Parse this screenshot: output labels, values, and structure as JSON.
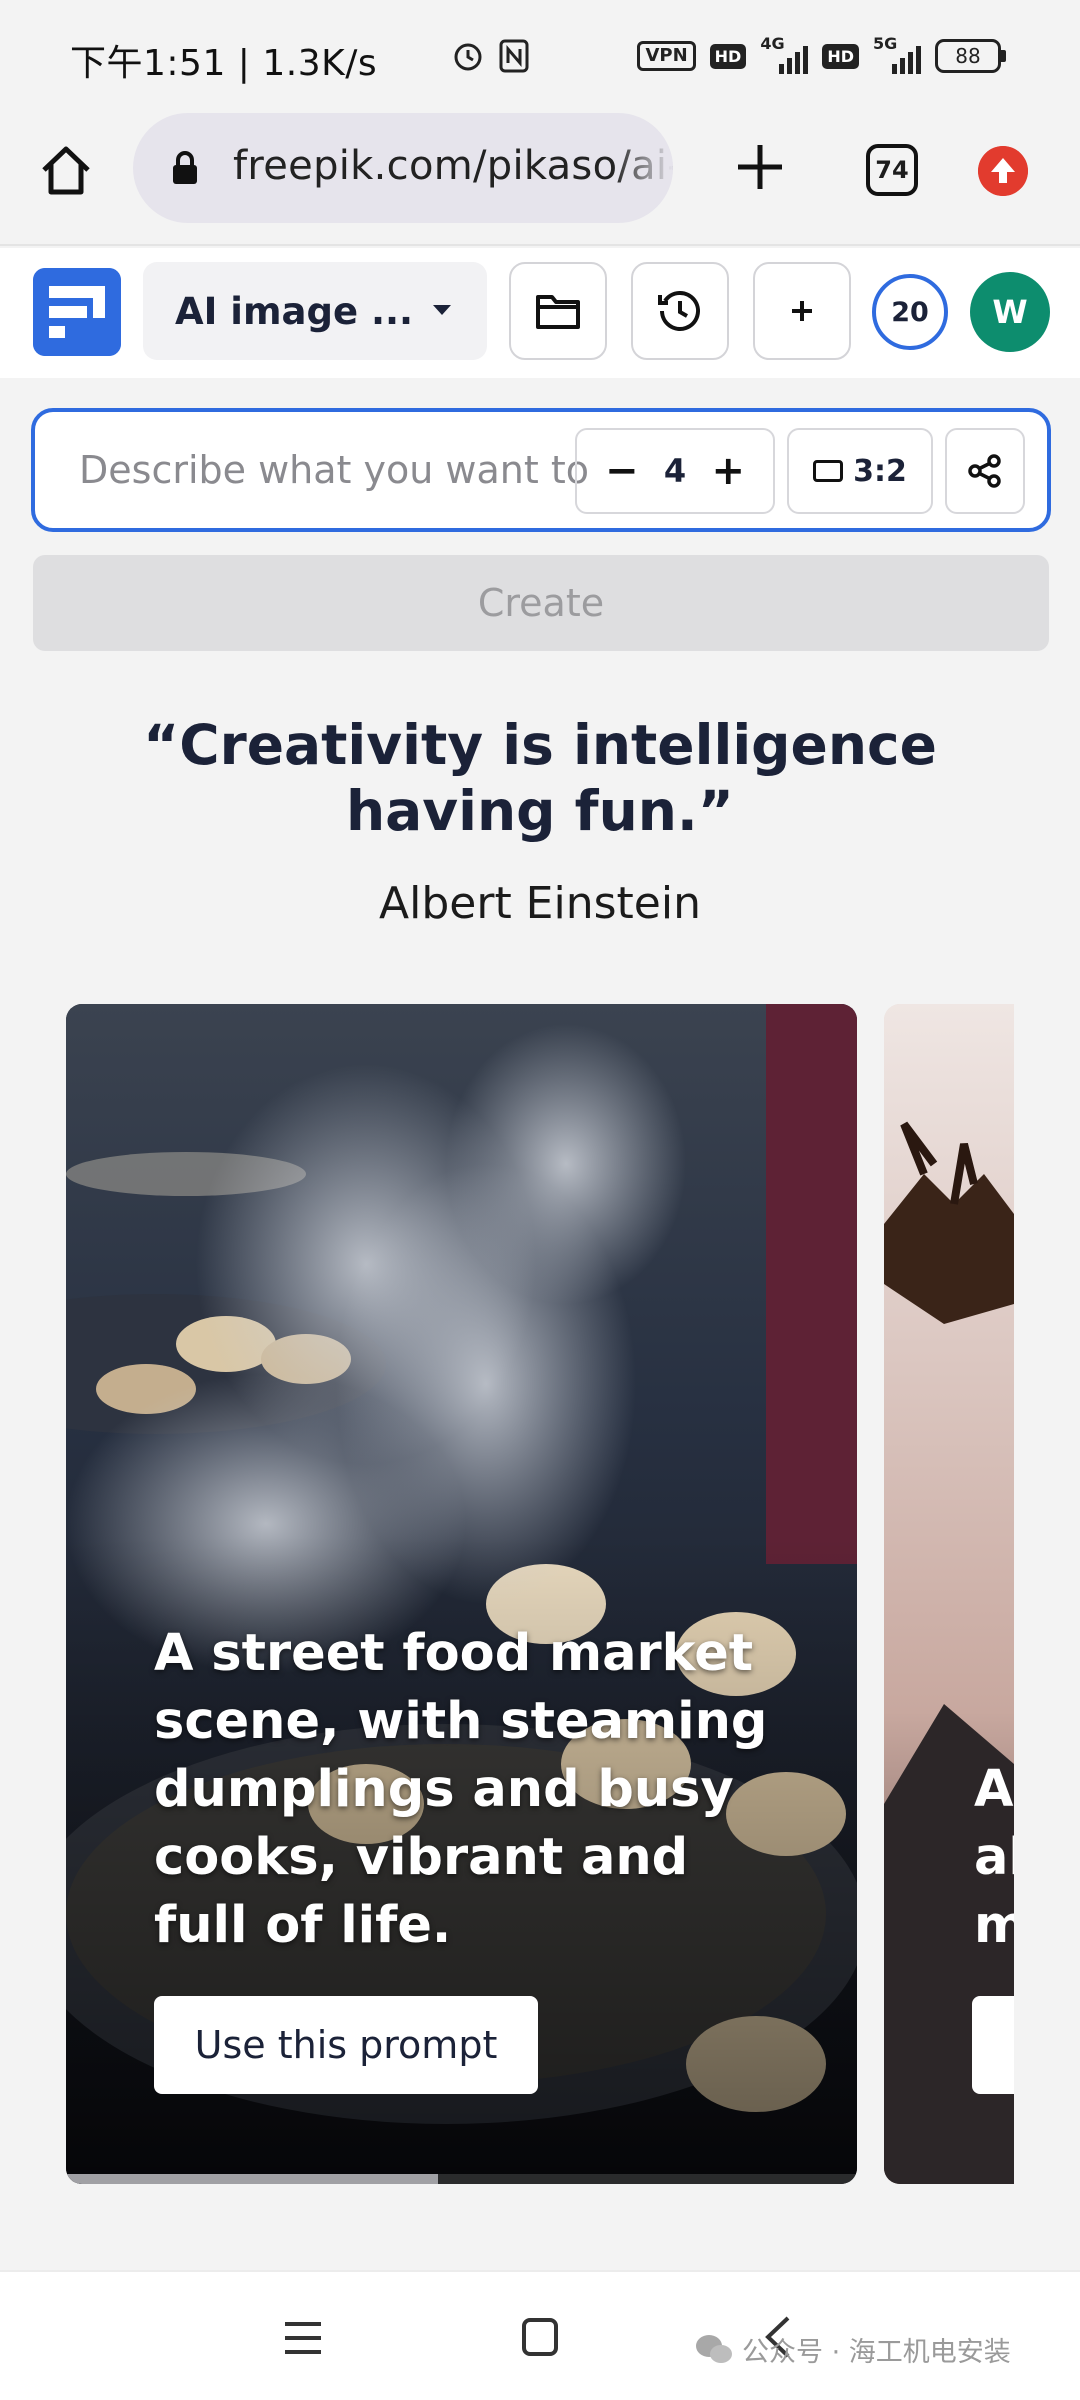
{
  "status_bar": {
    "time": "下午1:51 | 1.3K/s",
    "vpn": "VPN",
    "hd": "HD",
    "net1": "4G",
    "net2": "5G",
    "battery": "88"
  },
  "browser": {
    "url": "freepik.com/pikaso/ai-image-generator",
    "tab_count": "74"
  },
  "header": {
    "mode_label": "AI image ...",
    "credits": "20",
    "avatar_initial": "W"
  },
  "prompt": {
    "placeholder": "Describe what you want to see",
    "count": "4",
    "aspect_ratio": "3:2"
  },
  "create_label": "Create",
  "quote": {
    "text": "“Creativity is intelligence having fun.”",
    "author": "Albert Einstein"
  },
  "cards": [
    {
      "caption": "A street food market scene, with steaming dumplings and busy cooks, vibrant and full of life.",
      "button": "Use this prompt",
      "progress": 0.47
    },
    {
      "caption": "A\nab\nm"
    }
  ],
  "watermark": "公众号 · 海工机电安装",
  "colors": {
    "accent": "#2f6bdf",
    "avatar": "#0d8d6e",
    "update": "#e23b2e",
    "heading": "#1b2238"
  }
}
